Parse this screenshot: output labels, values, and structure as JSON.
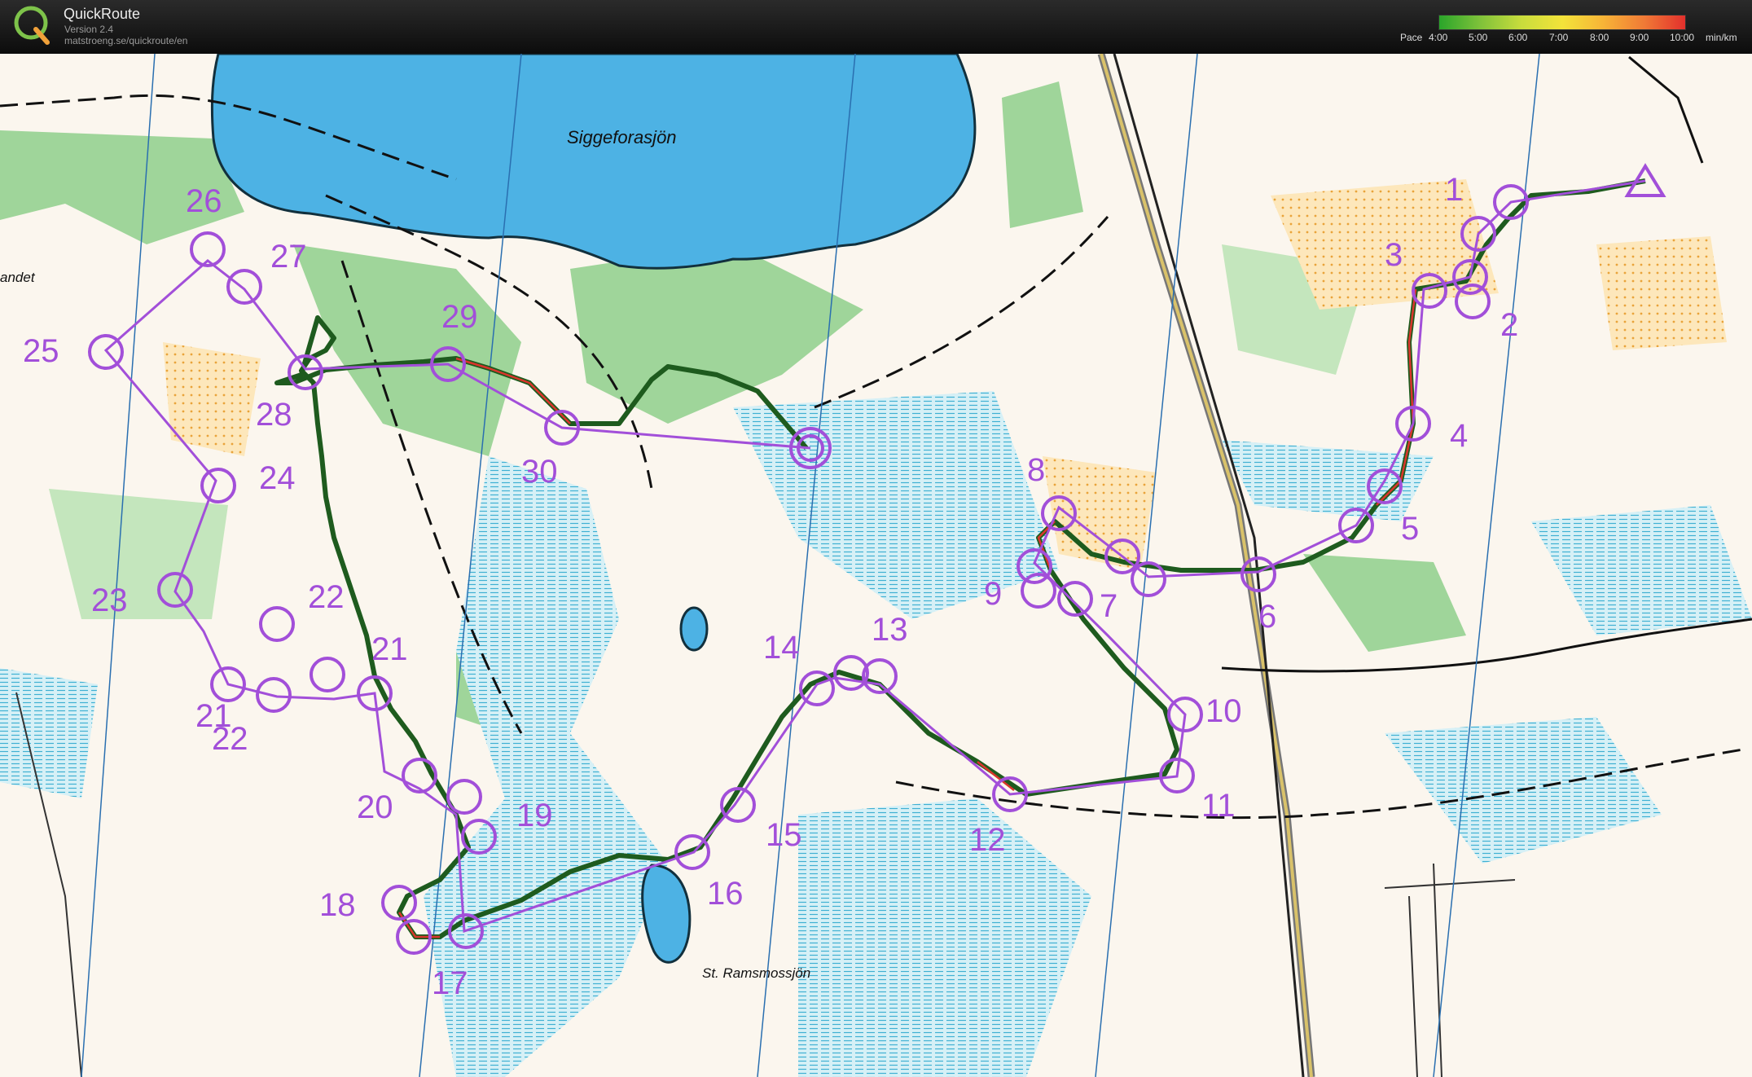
{
  "app": {
    "title": "QuickRoute",
    "version": "Version 2.4",
    "url": "matstroeng.se/quickroute/en"
  },
  "pace_legend": {
    "label": "Pace",
    "ticks": [
      "4:00",
      "5:00",
      "6:00",
      "7:00",
      "8:00",
      "9:00",
      "10:00"
    ],
    "unit": "min/km",
    "colors": [
      "#2aa52a",
      "#7fc23a",
      "#c8dc3c",
      "#f3e33a",
      "#f7b437",
      "#f07a36",
      "#e2302c"
    ]
  },
  "map": {
    "lake_names": [
      "Siggeforasjön",
      "St. Ramsmossjön"
    ],
    "edge_text": "andet",
    "course_color": "#a24fd9",
    "control_labels": [
      "1",
      "2",
      "3",
      "4",
      "5",
      "6",
      "7",
      "8",
      "9",
      "10",
      "11",
      "12",
      "13",
      "14",
      "15",
      "16",
      "17",
      "18",
      "19",
      "20",
      "21",
      "22",
      "23",
      "24",
      "25",
      "26",
      "27",
      "28",
      "29",
      "30",
      "21",
      "22"
    ]
  }
}
